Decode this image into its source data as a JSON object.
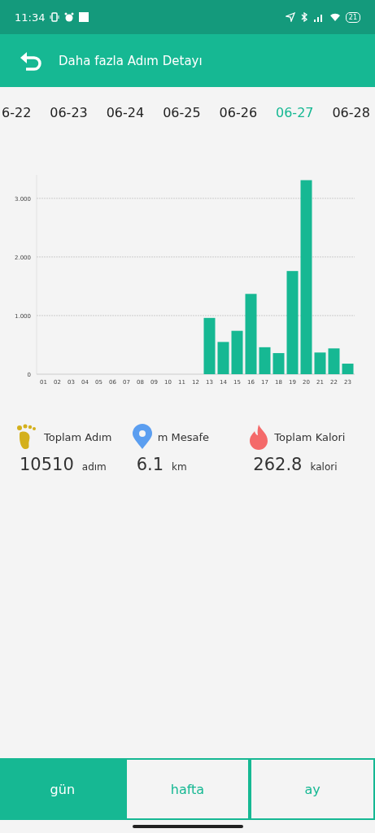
{
  "status_bar": {
    "time": "11:34",
    "battery": "21"
  },
  "header": {
    "title": "Daha fazla Adım Detayı"
  },
  "dates": [
    {
      "label": "6-22",
      "selected": false
    },
    {
      "label": "06-23",
      "selected": false
    },
    {
      "label": "06-24",
      "selected": false
    },
    {
      "label": "06-25",
      "selected": false
    },
    {
      "label": "06-26",
      "selected": false
    },
    {
      "label": "06-27",
      "selected": true
    },
    {
      "label": "06-28",
      "selected": false
    }
  ],
  "chart_data": {
    "type": "bar",
    "categories": [
      "01",
      "02",
      "03",
      "04",
      "05",
      "06",
      "07",
      "08",
      "09",
      "10",
      "11",
      "12",
      "13",
      "14",
      "15",
      "16",
      "17",
      "18",
      "19",
      "20",
      "21",
      "22",
      "23"
    ],
    "series": [
      {
        "color": "#16b893",
        "values": [
          0,
          0,
          0,
          0,
          0,
          0,
          0,
          0,
          0,
          0,
          0,
          0,
          0.96,
          0.55,
          0.74,
          1.37,
          0.46,
          0.36,
          1.76,
          3.31,
          0.37,
          0.44,
          0.18
        ]
      }
    ],
    "grid": true,
    "ylim": [
      0,
      3.4
    ],
    "yticks": [
      {
        "value": 0,
        "label": "0"
      },
      {
        "value": 1,
        "label": "1.000"
      },
      {
        "value": 2,
        "label": "2.000"
      },
      {
        "value": 3,
        "label": "3.000"
      }
    ]
  },
  "stats": [
    {
      "kind": "steps",
      "label": "Toplam Adım",
      "value": "10510",
      "unit": "adım"
    },
    {
      "kind": "distance",
      "label": "m Mesafe",
      "value": "6.1",
      "unit": "km"
    },
    {
      "kind": "calories",
      "label": "Toplam Kalori",
      "value": "262.8",
      "unit": "kalori"
    }
  ],
  "tabs": [
    {
      "label": "gün",
      "selected": true
    },
    {
      "label": "hafta",
      "selected": false
    },
    {
      "label": "ay",
      "selected": false
    }
  ]
}
